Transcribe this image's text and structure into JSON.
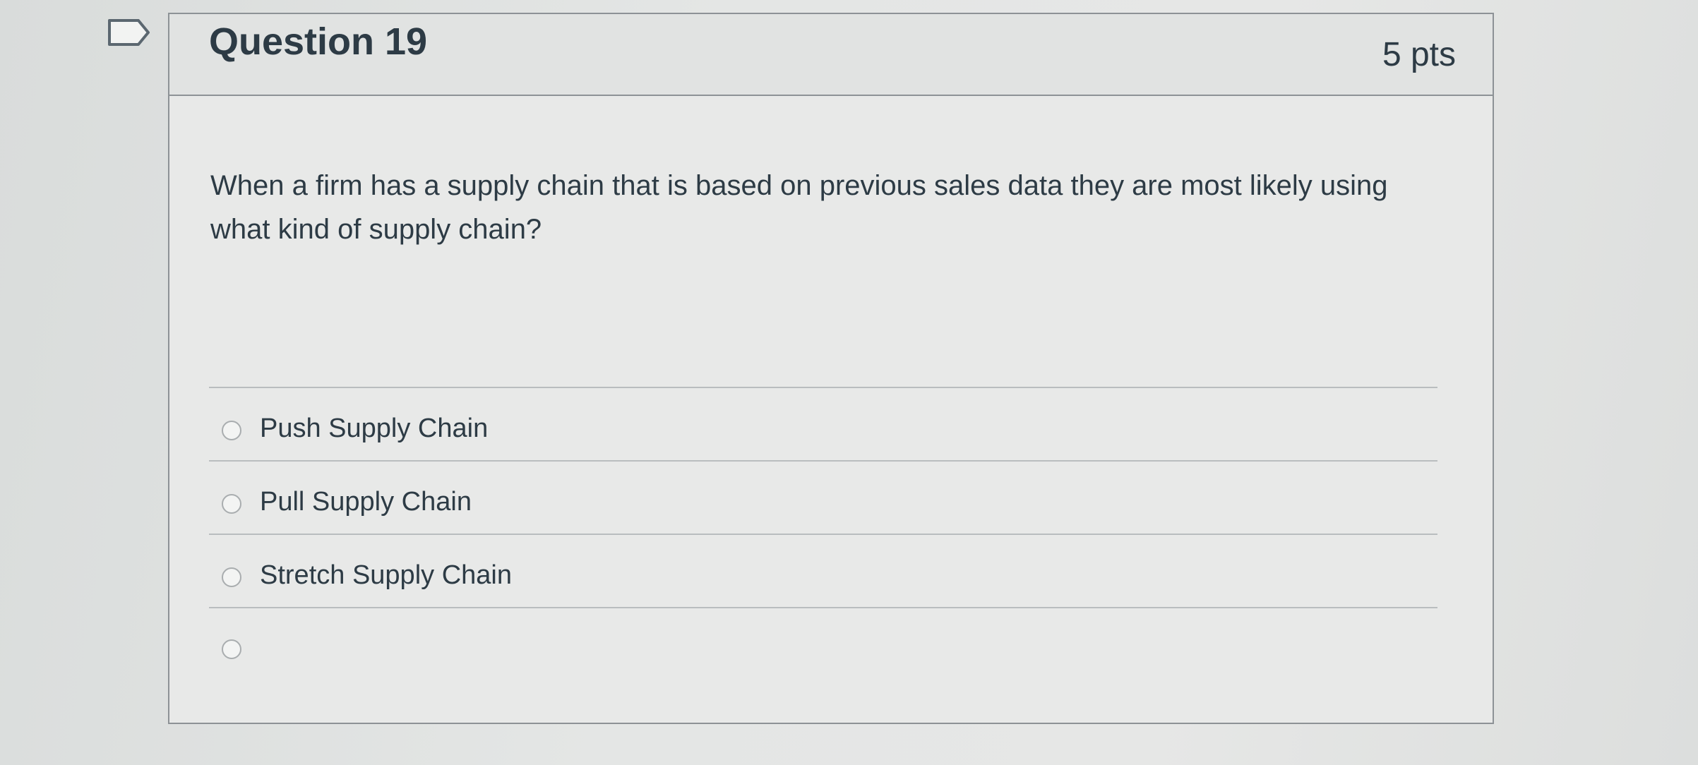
{
  "question": {
    "title": "Question 19",
    "points": "5 pts",
    "text": "When a firm has a supply chain that is based on previous sales data they are most likely using what kind of supply chain?",
    "flag_icon": "flag-icon"
  },
  "answers": [
    {
      "label": "Push Supply Chain"
    },
    {
      "label": "Pull Supply Chain"
    },
    {
      "label": "Stretch Supply Chain"
    },
    {
      "label": ""
    }
  ]
}
